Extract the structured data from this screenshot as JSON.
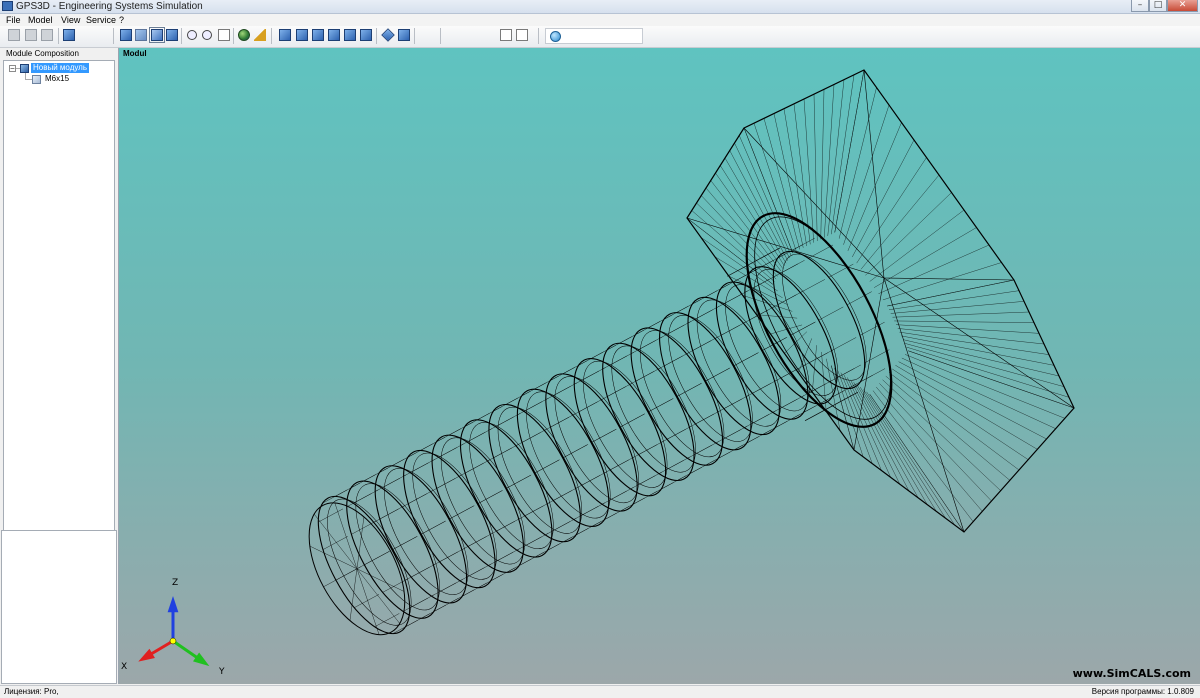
{
  "window": {
    "title": "GPS3D - Engineering Systems Simulation",
    "controls": {
      "minimize": "–",
      "maximize": "□",
      "close": "✕"
    }
  },
  "menu": {
    "items": [
      {
        "label": "File"
      },
      {
        "label": "Model"
      },
      {
        "label": "View"
      },
      {
        "label": "Service"
      },
      {
        "label": "?"
      }
    ]
  },
  "toolbar": {
    "icons": [
      "new-icon",
      "open-icon",
      "save-icon",
      "module-icon",
      "view-solid-icon",
      "view-transparent-icon",
      "view-wireframe-icon",
      "view-shaded-icon",
      "zoom-in-icon",
      "zoom-out-icon",
      "zoom-fit-icon",
      "globe-icon",
      "measure-icon",
      "view-front-icon",
      "view-back-icon",
      "view-left-icon",
      "view-right-icon",
      "view-top-icon",
      "view-bottom-icon",
      "view-iso-icon",
      "view-iso2-icon",
      "report-icon",
      "export-icon",
      "simulation-icon"
    ],
    "pressed": "view-wireframe-icon"
  },
  "left_panel": {
    "header": "Module Composition",
    "tree": {
      "expander": "–",
      "root": {
        "label": "Новый модуль",
        "selected": true
      },
      "children": [
        {
          "label": "M6x15"
        }
      ]
    }
  },
  "viewport": {
    "label": "Modul",
    "watermark": "www.SimCALS.com",
    "background_colors": [
      "#5fc3c0",
      "#9ca7aa"
    ],
    "mesh_color": "#000000",
    "axes": {
      "x": {
        "label": "X",
        "color": "#e02020"
      },
      "y": {
        "label": "Y",
        "color": "#20c020"
      },
      "z": {
        "label": "Z",
        "color": "#2040e0"
      }
    }
  },
  "status": {
    "left": "Лицензия: Pro,",
    "right": "Версия программы: 1.0.809"
  }
}
